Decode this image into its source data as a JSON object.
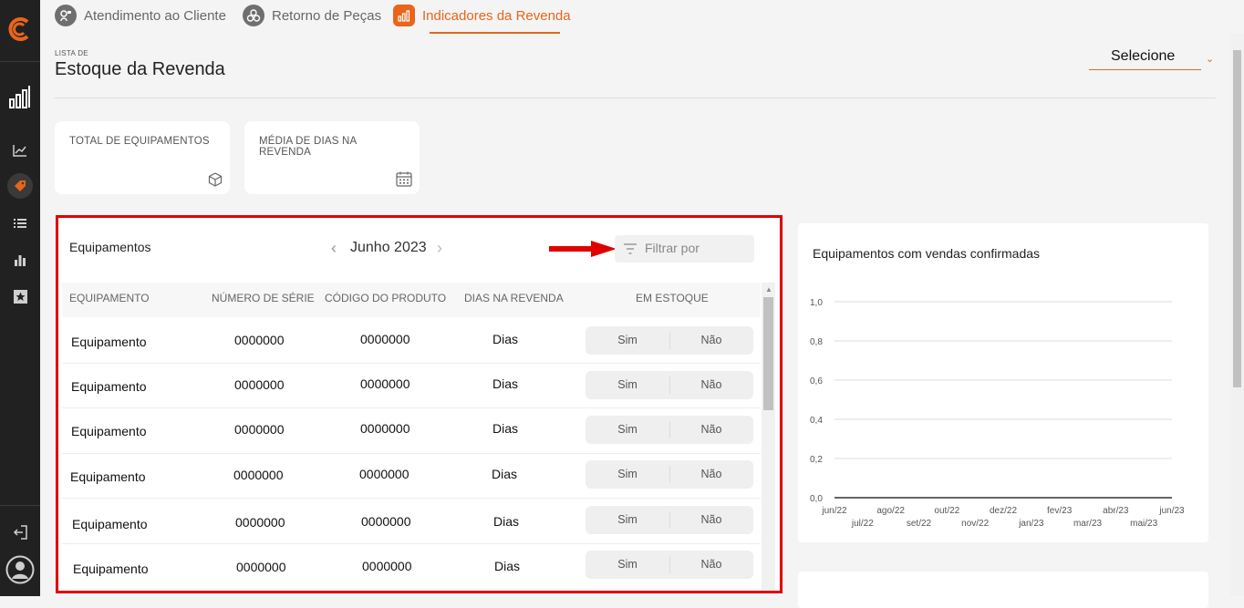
{
  "tabs": [
    {
      "label": "Atendimento ao Cliente",
      "icon": "headset-icon"
    },
    {
      "label": "Retorno de Peças",
      "icon": "parts-icon"
    },
    {
      "label": "Indicadores da Revenda",
      "icon": "bar-chart-icon"
    }
  ],
  "page": {
    "eyebrow": "LISTA DE",
    "title": "Estoque da Revenda",
    "select_value": "Selecione"
  },
  "kpis": {
    "total_equipamentos": "TOTAL DE EQUIPAMENTOS",
    "media_dias_l1": "MÉDIA DE DIAS NA",
    "media_dias_l2": "REVENDA"
  },
  "table": {
    "title": "Equipamentos",
    "period": "Junho 2023",
    "filter_placeholder": "Filtrar por",
    "headers": [
      "EQUIPAMENTO",
      "NÚMERO DE SÉRIE",
      "CÓDIGO DO PRODUTO",
      "DIAS NA REVENDA",
      "EM ESTOQUE"
    ],
    "toggle_yes": "Sim",
    "toggle_no": "Não",
    "rows": [
      {
        "equipamento": "Equipamento",
        "serie": "0000000",
        "codigo": "0000000",
        "dias": "Dias"
      },
      {
        "equipamento": "Equipamento",
        "serie": "0000000",
        "codigo": "0000000",
        "dias": "Dias"
      },
      {
        "equipamento": "Equipamento",
        "serie": "0000000",
        "codigo": "0000000",
        "dias": "Dias"
      },
      {
        "equipamento": "Equipamento",
        "serie": "0000000",
        "codigo": "0000000",
        "dias": "Dias"
      },
      {
        "equipamento": "Equipamento",
        "serie": "0000000",
        "codigo": "0000000",
        "dias": "Dias"
      },
      {
        "equipamento": "Equipamento",
        "serie": "0000000",
        "codigo": "0000000",
        "dias": "Dias"
      }
    ]
  },
  "colors": {
    "accent": "#e8651a",
    "highlight": "#e00000",
    "sidebar": "#212121"
  },
  "chart_data": {
    "type": "line",
    "title": "Equipamentos com vendas confirmadas",
    "x": [
      "jun/22",
      "jul/22",
      "ago/22",
      "set/22",
      "out/22",
      "nov/22",
      "dez/22",
      "jan/23",
      "fev/23",
      "mar/23",
      "abr/23",
      "mai/23",
      "jun/23"
    ],
    "series": [
      {
        "values": [
          0,
          0,
          0,
          0,
          0,
          0,
          0,
          0,
          0,
          0,
          0,
          0,
          0
        ]
      }
    ],
    "yticks": [
      "1,0",
      "0,8",
      "0,6",
      "0,4",
      "0,2",
      "0,0"
    ],
    "ylim": [
      0,
      1
    ],
    "grid": true
  }
}
